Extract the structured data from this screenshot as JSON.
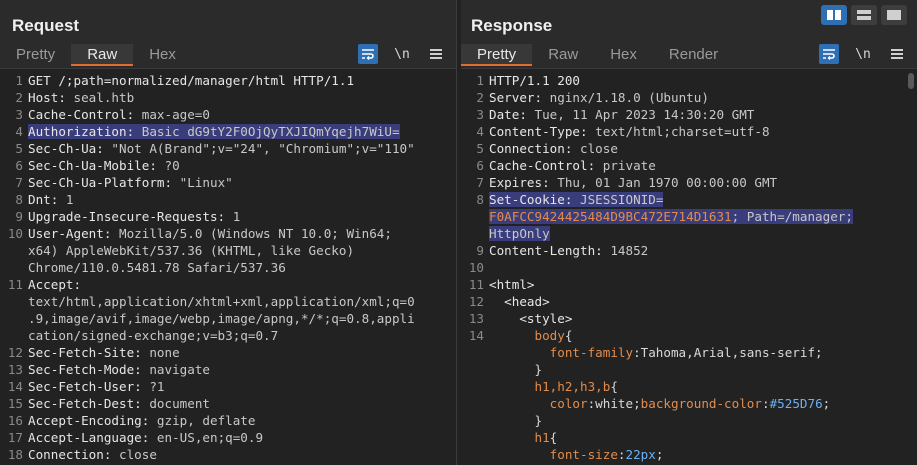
{
  "request": {
    "title": "Request",
    "tabs": [
      "Pretty",
      "Raw",
      "Hex"
    ],
    "active_tab": "Raw",
    "tool_newline_label": "\\n",
    "lines": [
      {
        "n": "1",
        "text": "GET /;path=normalized/manager/html HTTP/1.1"
      },
      {
        "n": "2",
        "key": "Host: ",
        "val": "seal.htb"
      },
      {
        "n": "3",
        "key": "Cache-Control: ",
        "val": "max-age=0"
      },
      {
        "n": "4",
        "key": "Authorization: ",
        "val": "Basic dG9tY2F0OjQyTXJIQmYqejh7WiU=",
        "highlight": true
      },
      {
        "n": "5",
        "key": "Sec-Ch-Ua: ",
        "val": "\"Not A(Brand\";v=\"24\", \"Chromium\";v=\"110\""
      },
      {
        "n": "6",
        "key": "Sec-Ch-Ua-Mobile: ",
        "val": "?0"
      },
      {
        "n": "7",
        "key": "Sec-Ch-Ua-Platform: ",
        "val": "\"Linux\""
      },
      {
        "n": "8",
        "key": "Dnt: ",
        "val": "1"
      },
      {
        "n": "9",
        "key": "Upgrade-Insecure-Requests: ",
        "val": "1"
      },
      {
        "n": "10",
        "key": "User-Agent: ",
        "val": "Mozilla/5.0 (Windows NT 10.0; Win64;"
      },
      {
        "n": "",
        "val": "x64) AppleWebKit/537.36 (KHTML, like Gecko)"
      },
      {
        "n": "",
        "val": "Chrome/110.0.5481.78 Safari/537.36"
      },
      {
        "n": "11",
        "key": "Accept: ",
        "val": ""
      },
      {
        "n": "",
        "val": "text/html,application/xhtml+xml,application/xml;q=0"
      },
      {
        "n": "",
        "val": ".9,image/avif,image/webp,image/apng,*/*;q=0.8,appli"
      },
      {
        "n": "",
        "val": "cation/signed-exchange;v=b3;q=0.7"
      },
      {
        "n": "12",
        "key": "Sec-Fetch-Site: ",
        "val": "none"
      },
      {
        "n": "13",
        "key": "Sec-Fetch-Mode: ",
        "val": "navigate"
      },
      {
        "n": "14",
        "key": "Sec-Fetch-User: ",
        "val": "?1"
      },
      {
        "n": "15",
        "key": "Sec-Fetch-Dest: ",
        "val": "document"
      },
      {
        "n": "16",
        "key": "Accept-Encoding: ",
        "val": "gzip, deflate"
      },
      {
        "n": "17",
        "key": "Accept-Language: ",
        "val": "en-US,en;q=0.9"
      },
      {
        "n": "18",
        "key": "Connection: ",
        "val": "close"
      }
    ]
  },
  "response": {
    "title": "Response",
    "tabs": [
      "Pretty",
      "Raw",
      "Hex",
      "Render"
    ],
    "active_tab": "Pretty",
    "tool_newline_label": "\\n",
    "lines": [
      {
        "n": "1",
        "text": "HTTP/1.1 200"
      },
      {
        "n": "2",
        "key": "Server: ",
        "val": "nginx/1.18.0 (Ubuntu)"
      },
      {
        "n": "3",
        "key": "Date: ",
        "val": "Tue, 11 Apr 2023 14:30:20 GMT"
      },
      {
        "n": "4",
        "key": "Content-Type: ",
        "val": "text/html;charset=utf-8"
      },
      {
        "n": "5",
        "key": "Connection: ",
        "val": "close"
      },
      {
        "n": "6",
        "key": "Cache-Control: ",
        "val": "private"
      },
      {
        "n": "7",
        "key": "Expires: ",
        "val": "Thu, 01 Jan 1970 00:00:00 GMT"
      },
      {
        "n": "8",
        "key": "Set-Cookie: ",
        "val": "JSESSIONID=",
        "highlight": true
      },
      {
        "n": "",
        "parts": [
          {
            "t": "F0AFCC9424425484D9BC472E714D1631",
            "c": "css-prop"
          },
          {
            "t": "; Path=/manager;",
            "c": "val"
          }
        ],
        "highlight": true
      },
      {
        "n": "",
        "val": "HttpOnly",
        "highlight": true
      },
      {
        "n": "9",
        "key": "Content-Length: ",
        "val": "14852"
      },
      {
        "n": "10",
        "text": ""
      },
      {
        "n": "11",
        "text": "<html>"
      },
      {
        "n": "12",
        "text": "  <head>"
      },
      {
        "n": "13",
        "text": "    <style>"
      },
      {
        "n": "14",
        "parts": [
          {
            "t": "      body",
            "c": "css-sel"
          },
          {
            "t": "{",
            "c": "css-val"
          }
        ]
      },
      {
        "n": "",
        "parts": [
          {
            "t": "        font-family",
            "c": "css-prop"
          },
          {
            "t": ":Tahoma,Arial,sans-serif;",
            "c": "css-val"
          }
        ]
      },
      {
        "n": "",
        "parts": [
          {
            "t": "      }",
            "c": "css-val"
          }
        ]
      },
      {
        "n": "",
        "parts": [
          {
            "t": "      h1,h2,h3,b",
            "c": "css-sel"
          },
          {
            "t": "{",
            "c": "css-val"
          }
        ]
      },
      {
        "n": "",
        "parts": [
          {
            "t": "        color",
            "c": "css-prop"
          },
          {
            "t": ":white;",
            "c": "css-val"
          },
          {
            "t": "background-color",
            "c": "css-prop"
          },
          {
            "t": ":",
            "c": "css-val"
          },
          {
            "t": "#525D76",
            "c": "css-num"
          },
          {
            "t": ";",
            "c": "css-val"
          }
        ]
      },
      {
        "n": "",
        "parts": [
          {
            "t": "      }",
            "c": "css-val"
          }
        ]
      },
      {
        "n": "",
        "parts": [
          {
            "t": "      h1",
            "c": "css-sel"
          },
          {
            "t": "{",
            "c": "css-val"
          }
        ]
      },
      {
        "n": "",
        "parts": [
          {
            "t": "        font-size",
            "c": "css-prop"
          },
          {
            "t": ":",
            "c": "css-val"
          },
          {
            "t": "22px",
            "c": "css-num"
          },
          {
            "t": ";",
            "c": "css-val"
          }
        ]
      },
      {
        "n": "",
        "parts": [
          {
            "t": "      }",
            "c": "css-val"
          }
        ]
      }
    ]
  },
  "colors": {
    "accent": "#2f6fb3",
    "tab_underline": "#e06c2e",
    "highlight": "#3a3d7c",
    "css_keyword": "#e38c4a",
    "css_number": "#6cb1f0"
  },
  "icons": [
    "word-wrap-icon",
    "newline-icon",
    "menu-icon",
    "layout-side-by-side-icon",
    "layout-stacked-icon",
    "layout-tabbed-icon"
  ]
}
